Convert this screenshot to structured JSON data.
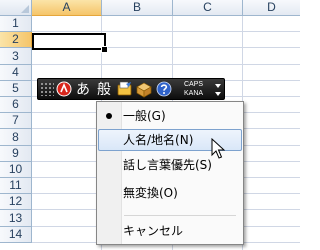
{
  "columns": [
    {
      "label": "A",
      "active": true
    },
    {
      "label": "B",
      "active": false
    },
    {
      "label": "C",
      "active": false
    },
    {
      "label": "D",
      "active": false
    }
  ],
  "rows": [
    {
      "label": "1",
      "active": false
    },
    {
      "label": "2",
      "active": true
    },
    {
      "label": "3",
      "active": false
    },
    {
      "label": "4",
      "active": false
    },
    {
      "label": "5",
      "active": false
    },
    {
      "label": "6",
      "active": false
    },
    {
      "label": "7",
      "active": false
    },
    {
      "label": "8",
      "active": false
    },
    {
      "label": "9",
      "active": false
    },
    {
      "label": "10",
      "active": false
    },
    {
      "label": "11",
      "active": false
    },
    {
      "label": "12",
      "active": false
    },
    {
      "label": "13",
      "active": false
    },
    {
      "label": "14",
      "active": false
    }
  ],
  "ime_bar": {
    "input_mode": "あ",
    "conversion_mode": "般",
    "caps_label": "CAPS",
    "kana_label": "KANA"
  },
  "menu": {
    "items": [
      {
        "label": "一般(G)",
        "checked": true,
        "highlighted": false
      },
      {
        "label": "人名/地名(N)",
        "checked": false,
        "highlighted": true
      },
      {
        "label": "話し言葉優先(S)",
        "checked": false,
        "highlighted": false
      },
      {
        "label": "無変換(O)",
        "checked": false,
        "highlighted": false
      }
    ],
    "cancel_label": "キャンセル"
  },
  "colors": {
    "header_active": "#f5c56a",
    "grid_line": "#d0d7e5",
    "menu_highlight": "#d9e7f8",
    "toolbar_bg": "#0d0d0d"
  }
}
